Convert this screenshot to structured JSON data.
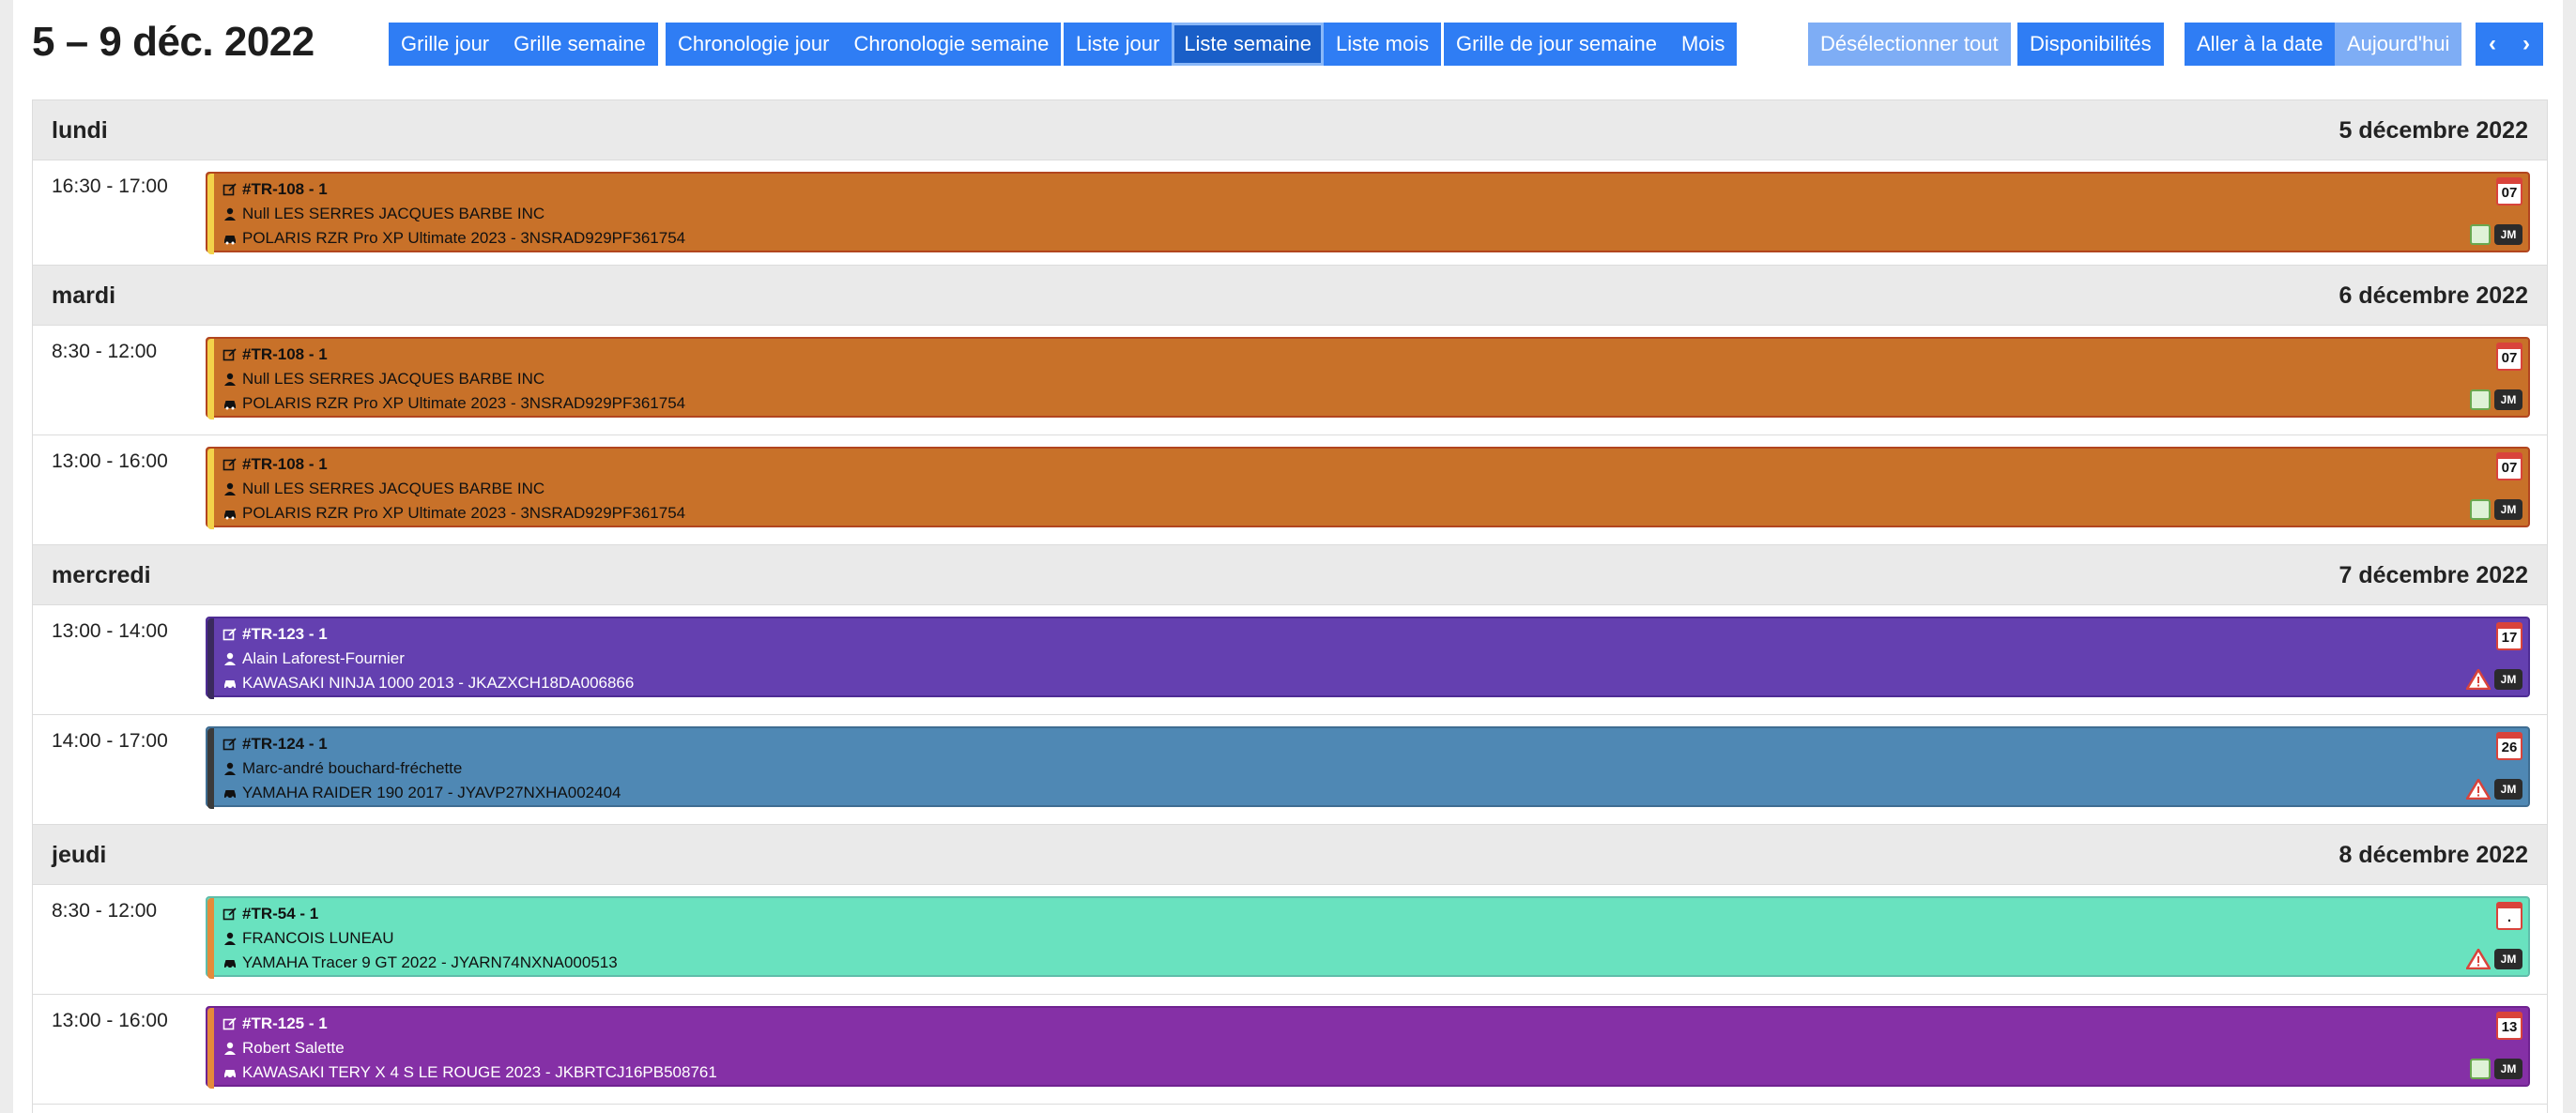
{
  "header": {
    "title": "5 – 9 déc. 2022"
  },
  "toolbar": {
    "group1": [
      "Grille jour",
      "Grille semaine"
    ],
    "group2": [
      "Chronologie jour",
      "Chronologie semaine"
    ],
    "group3": [
      "Liste jour",
      "Liste semaine",
      "Liste mois"
    ],
    "group4": [
      "Grille de jour semaine",
      "Mois"
    ],
    "deselect": "Désélectionner tout",
    "availability": "Disponibilités",
    "goto": "Aller à la date",
    "today": "Aujourd'hui",
    "prev": "‹",
    "next": "›"
  },
  "days": [
    {
      "name": "lundi",
      "date": "5 décembre 2022"
    },
    {
      "name": "mardi",
      "date": "6 décembre 2022"
    },
    {
      "name": "mercredi",
      "date": "7 décembre 2022"
    },
    {
      "name": "jeudi",
      "date": "8 décembre 2022"
    }
  ],
  "events": [
    {
      "time": "16:30 - 17:00",
      "id": "#TR-108 - 1",
      "client": "Null LES SERRES JACQUES BARBE INC",
      "vehicle": "POLARIS RZR Pro XP Ultimate 2023 - 3NSRAD929PF361754",
      "cal": "07",
      "initials": "JM",
      "color": "#c87129"
    },
    {
      "time": "8:30 - 12:00",
      "id": "#TR-108 - 1",
      "client": "Null LES SERRES JACQUES BARBE INC",
      "vehicle": "POLARIS RZR Pro XP Ultimate 2023 - 3NSRAD929PF361754",
      "cal": "07",
      "initials": "JM",
      "color": "#c87129"
    },
    {
      "time": "13:00 - 16:00",
      "id": "#TR-108 - 1",
      "client": "Null LES SERRES JACQUES BARBE INC",
      "vehicle": "POLARIS RZR Pro XP Ultimate 2023 - 3NSRAD929PF361754",
      "cal": "07",
      "initials": "JM",
      "color": "#c87129"
    },
    {
      "time": "13:00 - 14:00",
      "id": "#TR-123 - 1",
      "client": "Alain Laforest-Fournier",
      "vehicle": "KAWASAKI NINJA 1000 2013 - JKAZXCH18DA006866",
      "cal": "17",
      "initials": "JM",
      "color": "#6440b0"
    },
    {
      "time": "14:00 - 17:00",
      "id": "#TR-124 - 1",
      "client": "Marc-andré bouchard-fréchette",
      "vehicle": "YAMAHA RAIDER 190 2017 - JYAVP27NXHA002404",
      "cal": "26",
      "initials": "JM",
      "color": "#4f88b4"
    },
    {
      "time": "8:30 - 12:00",
      "id": "#TR-54 - 1",
      "client": "FRANCOIS LUNEAU",
      "vehicle": "YAMAHA Tracer 9 GT 2022 - JYARN74NXNA000513",
      "cal": ".",
      "initials": "JM",
      "color": "#69e2bf"
    },
    {
      "time": "13:00 - 16:00",
      "id": "#TR-125 - 1",
      "client": "Robert Salette",
      "vehicle": "KAWASAKI TERY X 4 S LE ROUGE 2023 - JKBRTCJ16PB508761",
      "cal": "13",
      "initials": "JM",
      "color": "#8530a6"
    }
  ]
}
